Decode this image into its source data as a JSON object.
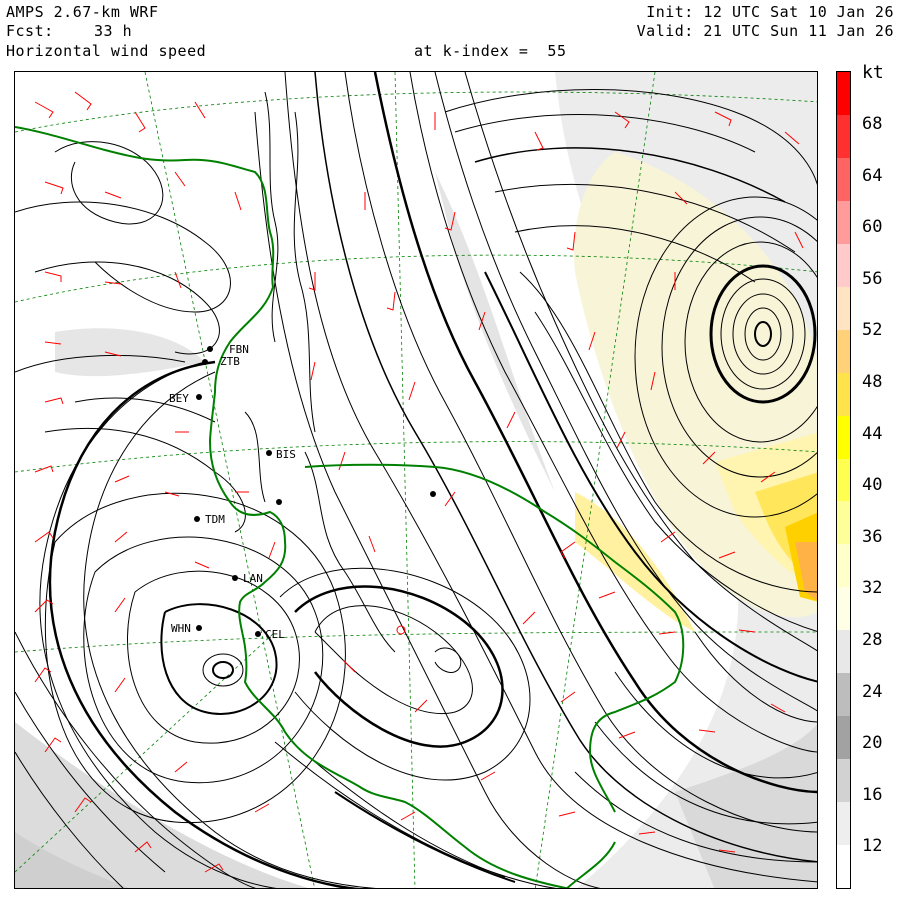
{
  "header": {
    "model": "AMPS 2.67-km WRF",
    "forecast_label": "Fcst:",
    "forecast_hours": "33 h",
    "field": "Horizontal wind speed",
    "init": "Init: 12 UTC Sat 10 Jan 26",
    "valid": "Valid: 21 UTC Sun 11 Jan 26",
    "level": "at k-index =  55"
  },
  "colorbar": {
    "unit": "kt",
    "labels": [
      "68",
      "64",
      "60",
      "56",
      "52",
      "48",
      "44",
      "40",
      "36",
      "32",
      "28",
      "24",
      "20",
      "16",
      "12"
    ],
    "colors": [
      "#ff0000",
      "#ff3030",
      "#ff6464",
      "#ff9b9b",
      "#ffcaca",
      "#ffe4c4",
      "#ffd27a",
      "#ffe34a",
      "#ffff00",
      "#ffff52",
      "#ffff99",
      "#ffffc9",
      "#ffffe6",
      "#e8e8e8",
      "#bdbdbd",
      "#a2a2a2",
      "#d2d2d2",
      "#eeeeee",
      "#ffffff"
    ]
  },
  "stations": [
    {
      "name": "FBN"
    },
    {
      "name": "ZTB"
    },
    {
      "name": "BEY"
    },
    {
      "name": "BIS"
    },
    {
      "name": "TDM"
    },
    {
      "name": "LAN"
    },
    {
      "name": "WHN"
    },
    {
      "name": "CEL"
    }
  ],
  "map_colors": {
    "coast": "#008000",
    "barbs": "#ff0000",
    "grid": "#008000",
    "streamlines": "#000000"
  }
}
